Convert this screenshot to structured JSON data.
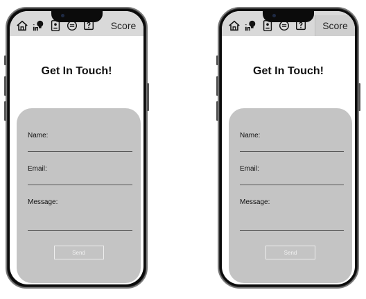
{
  "phones": [
    {
      "id": "left",
      "nav": {
        "icons": [
          "home-icon",
          "tips-icon",
          "badge-icon",
          "chat-icon",
          "help-icon"
        ],
        "score_label": "Score"
      },
      "title": "Get In Touch!",
      "form": {
        "name_label": "Name:",
        "email_label": "Email:",
        "message_label": "Message:",
        "send_label": "Send"
      }
    },
    {
      "id": "right",
      "nav": {
        "icons": [
          "home-icon",
          "tips-icon",
          "badge-icon",
          "chat-icon",
          "help-icon"
        ],
        "score_label": "Score"
      },
      "title": "Get In Touch!",
      "form": {
        "name_label": "Name:",
        "email_label": "Email:",
        "message_label": "Message:",
        "send_label": "Send"
      }
    }
  ],
  "colors": {
    "nav_bg": "#d9d9d9",
    "form_bg": "#c4c4c4",
    "bezel": "#0b0b0b"
  }
}
